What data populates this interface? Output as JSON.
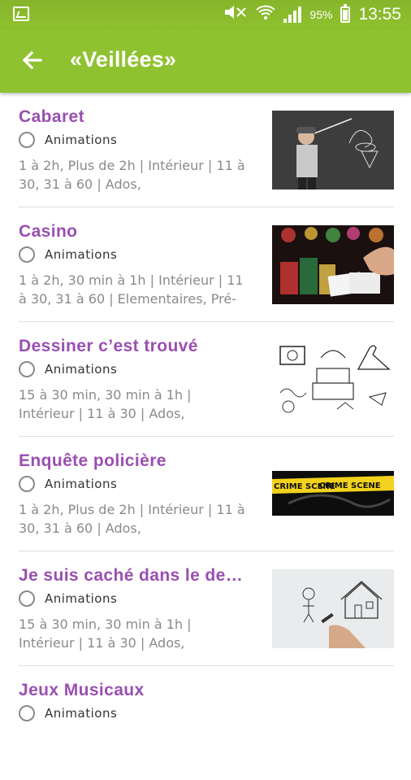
{
  "status_bar": {
    "battery": "95%",
    "time": "13:55"
  },
  "header": {
    "title": "«Veillées»"
  },
  "items": [
    {
      "title": "Cabaret",
      "category": "Animations",
      "description": "1 à 2h, Plus de 2h | Intérieur | 11 à 30, 31 à 60 | Ados,"
    },
    {
      "title": "Casino",
      "category": "Animations",
      "description": "1 à 2h, 30 min à 1h | Intérieur | 11 à 30, 31 à 60 | Elementaires, Pré-"
    },
    {
      "title": "Dessiner c’est trouvé",
      "category": "Animations",
      "description": "15 à 30 min, 30 min à 1h | Intérieur | 11 à 30 | Ados,"
    },
    {
      "title": "Enquête policière",
      "category": "Animations",
      "description": "1 à 2h, Plus de 2h | Intérieur | 11 à 30, 31 à 60 | Ados,"
    },
    {
      "title": "Je suis caché dans le de…",
      "category": "Animations",
      "description": "15 à 30 min, 30 min à 1h | Intérieur | 11 à 30 | Ados,"
    },
    {
      "title": "Jeux Musicaux",
      "category": "Animations",
      "description": ""
    }
  ],
  "crime_tape_text": "CRIME SCENE",
  "colors": {
    "accent": "#8fc230",
    "title": "#9a4fb0",
    "text": "#8a8a8a"
  }
}
